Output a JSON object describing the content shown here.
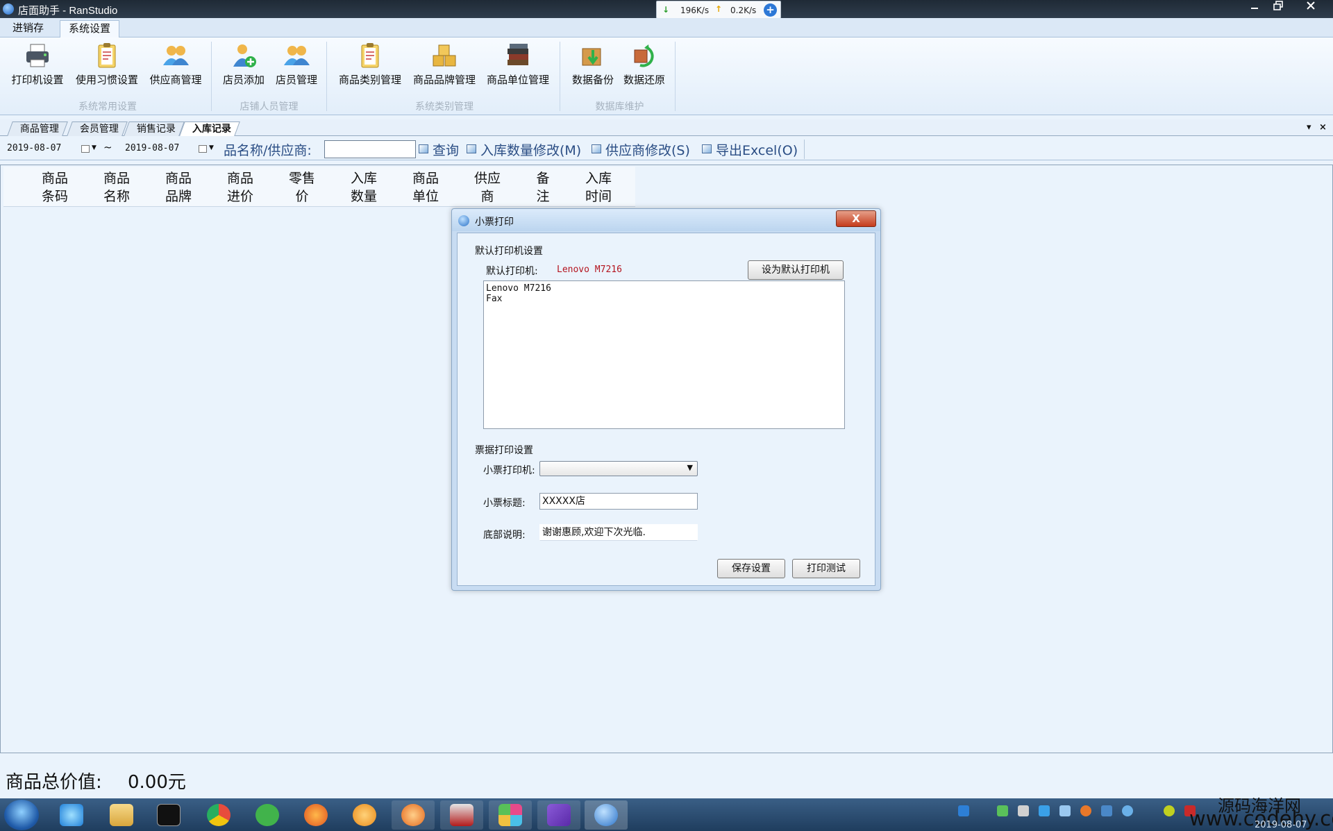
{
  "window": {
    "title": "店面助手 - RanStudio",
    "net_down": "196K/s",
    "net_up": "0.2K/s",
    "net_plus": "+"
  },
  "menu": {
    "tabs": [
      {
        "label": "进销存"
      },
      {
        "label": "系统设置"
      }
    ]
  },
  "ribbon": {
    "buttons": [
      {
        "label": "打印机设置"
      },
      {
        "label": "使用习惯设置"
      },
      {
        "label": "供应商管理"
      },
      {
        "label": "店员添加"
      },
      {
        "label": "店员管理"
      },
      {
        "label": "商品类别管理"
      },
      {
        "label": "商品品牌管理"
      },
      {
        "label": "商品单位管理"
      },
      {
        "label": "数据备份"
      },
      {
        "label": "数据还原"
      }
    ],
    "groups": [
      {
        "label": "系统常用设置"
      },
      {
        "label": "店铺人员管理"
      },
      {
        "label": "系统类别管理"
      },
      {
        "label": "数据库维护"
      }
    ]
  },
  "doctabs": {
    "tabs": [
      {
        "label": "商品管理"
      },
      {
        "label": "会员管理"
      },
      {
        "label": "销售记录"
      },
      {
        "label": "入库记录"
      }
    ],
    "close": "×",
    "menu": "▾"
  },
  "toolbar": {
    "date_from": "2019-08-07",
    "date_to": "2019-08-07",
    "tilde": "~",
    "search_label": "品名称/供应商:",
    "search_value": "",
    "query": "查询",
    "modify_qty": "入库数量修改(M)",
    "modify_supplier": "供应商修改(S)",
    "export": "导出Excel(O)"
  },
  "grid": {
    "columns": [
      {
        "line1": "商品",
        "line2": "条码"
      },
      {
        "line1": "商品",
        "line2": "名称"
      },
      {
        "line1": "商品",
        "line2": "品牌"
      },
      {
        "line1": "商品",
        "line2": "进价"
      },
      {
        "line1": "零售",
        "line2": "价"
      },
      {
        "line1": "入库",
        "line2": "数量"
      },
      {
        "line1": "商品",
        "line2": "单位"
      },
      {
        "line1": "供应",
        "line2": "商"
      },
      {
        "line1": "备",
        "line2": "注"
      },
      {
        "line1": "入库",
        "line2": "时间"
      }
    ]
  },
  "dialog": {
    "title": "小票打印",
    "close": "X",
    "default_section": "默认打印机设置",
    "default_label": "默认打印机:",
    "default_value": "Lenovo M7216",
    "set_default_button": "设为默认打印机",
    "printers": [
      "Lenovo M7216",
      "Fax"
    ],
    "receipt_section": "票据打印设置",
    "receipt_printer_label": "小票打印机:",
    "receipt_printer_value": "",
    "receipt_title_label": "小票标题:",
    "receipt_title_value": "XXXXX店",
    "footer_label": "底部说明:",
    "footer_value": "谢谢惠顾,欢迎下次光临.",
    "save_button": "保存设置",
    "test_button": "打印测试"
  },
  "footer": {
    "total_label": "商品总价值:",
    "total_value": "0.00元"
  },
  "taskbar": {
    "watermark_cn": "源码海洋网",
    "watermark_url": "www.codehy.com",
    "clock": "2019-08-07"
  },
  "colors": {
    "accent_text": "#2a4d84",
    "printer_red": "#b4141f",
    "background": "#eaf3fc"
  }
}
